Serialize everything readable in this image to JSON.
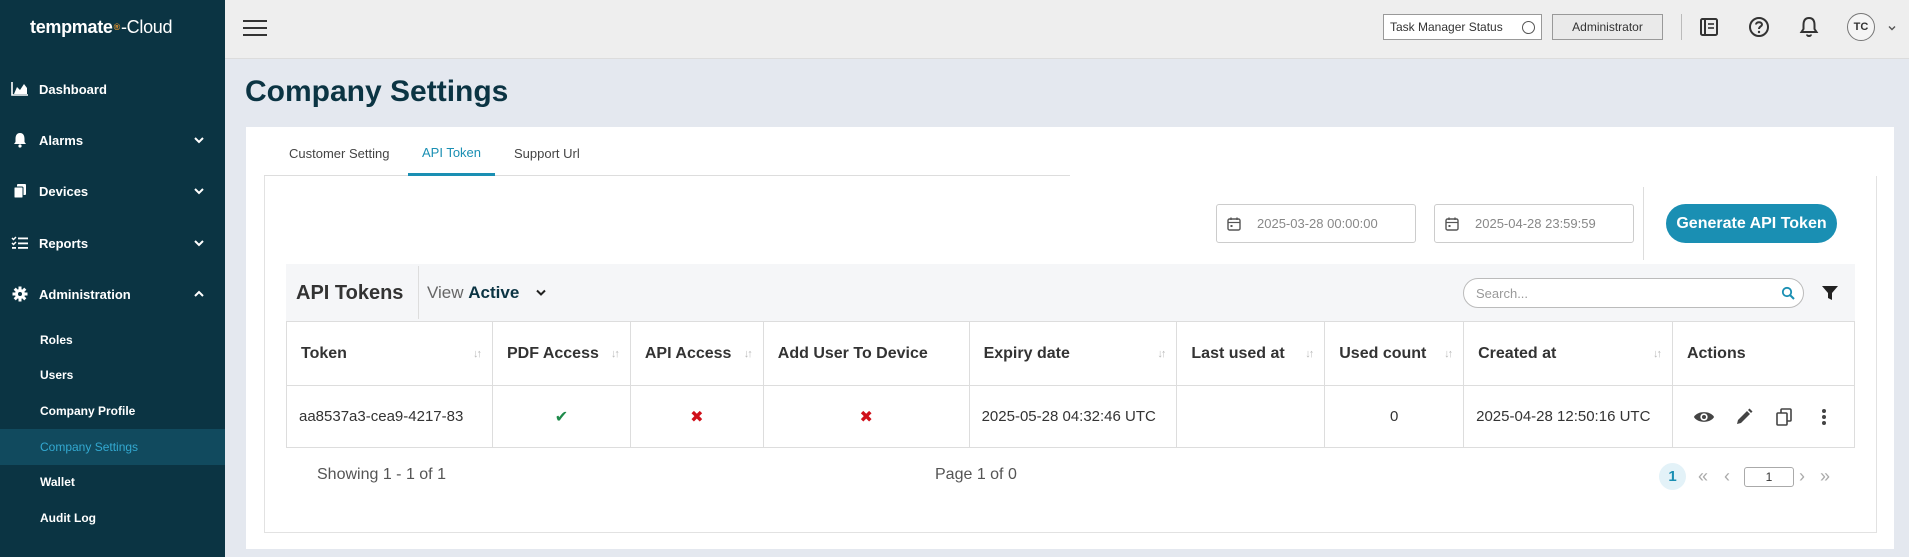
{
  "sidebar": {
    "logo": {
      "brand": "tempmate",
      "mark": "®",
      "suffix": "-Cloud"
    },
    "items": [
      {
        "label": "Dashboard",
        "icon": "chart-area-icon"
      },
      {
        "label": "Alarms",
        "icon": "bell-icon"
      },
      {
        "label": "Devices",
        "icon": "device-icon"
      },
      {
        "label": "Reports",
        "icon": "list-icon"
      },
      {
        "label": "Administration",
        "icon": "gear-icon"
      }
    ],
    "sub_items": [
      {
        "label": "Roles"
      },
      {
        "label": "Users"
      },
      {
        "label": "Company Profile"
      },
      {
        "label": "Company Settings"
      },
      {
        "label": "Wallet"
      },
      {
        "label": "Audit Log"
      }
    ]
  },
  "topbar": {
    "task_manager_label": "Task Manager Status",
    "admin_label": "Administrator",
    "avatar_initials": "TC"
  },
  "page": {
    "title": "Company Settings"
  },
  "tabs": [
    {
      "label": "Customer Setting"
    },
    {
      "label": "API Token"
    },
    {
      "label": "Support Url"
    }
  ],
  "filters": {
    "date_from": "2025-03-28 00:00:00",
    "date_to": "2025-04-28 23:59:59",
    "generate_label": "Generate API Token"
  },
  "table": {
    "title": "API Tokens",
    "view_prefix": "View",
    "view_value": "Active",
    "search_placeholder": "Search...",
    "columns": [
      "Token",
      "PDF Access",
      "API Access",
      "Add User To Device",
      "Expiry date",
      "Last used at",
      "Used count",
      "Created at",
      "Actions"
    ],
    "rows": [
      {
        "token": "aa8537a3-cea9-4217-83",
        "pdf_access": "✔",
        "api_access": "✖",
        "add_user": "✖",
        "expiry": "2025-05-28 04:32:46 UTC",
        "last_used": "",
        "used_count": "0",
        "created": "2025-04-28 12:50:16 UTC"
      }
    ],
    "showing": "Showing 1 - 1 of 1",
    "page_info": "Page 1 of 0",
    "current_page": "1",
    "page_input": "1"
  },
  "colors": {
    "sidebar_bg": "#0b3443",
    "accent": "#1a8fb3",
    "active_sub": "#114a5e"
  }
}
